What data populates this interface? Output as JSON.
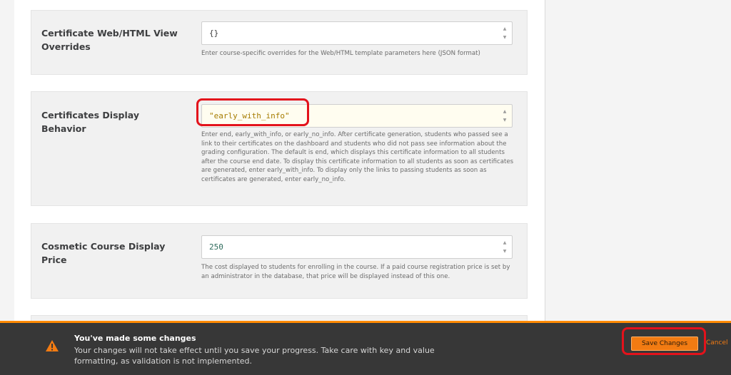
{
  "settings": [
    {
      "label": "Certificate Web/HTML View Overrides",
      "value": "{}",
      "help": "Enter course-specific overrides for the Web/HTML template parameters here (JSON format)"
    },
    {
      "label": "Certificates Display Behavior",
      "value": "\"early_with_info\"",
      "help": "Enter end, early_with_info, or early_no_info. After certificate generation, students who passed see a link to their certificates on the dashboard and students who did not pass see information about the grading configuration. The default is end, which displays this certificate information to all students after the course end date. To display this certificate information to all students as soon as certificates are generated, enter early_with_info. To display only the links to passing students as soon as certificates are generated, enter early_no_info."
    },
    {
      "label": "Cosmetic Course Display Price",
      "value": "250",
      "help": "The cost displayed to students for enrolling in the course. If a paid course registration price is set by an administrator in the database, that price will be displayed instead of this one."
    }
  ],
  "notification": {
    "title": "You've made some changes",
    "message": "Your changes will not take effect until you save your progress. Take care with key and value formatting, as validation is not implemented.",
    "save_label": "Save Changes",
    "cancel_label": "Cancel"
  },
  "icons": {
    "warning": "warning-icon",
    "spinner": "spinner-arrows-icon"
  },
  "colors": {
    "accent": "#f27b12",
    "annotation": "#e3121b",
    "notice_bg": "#373737"
  }
}
